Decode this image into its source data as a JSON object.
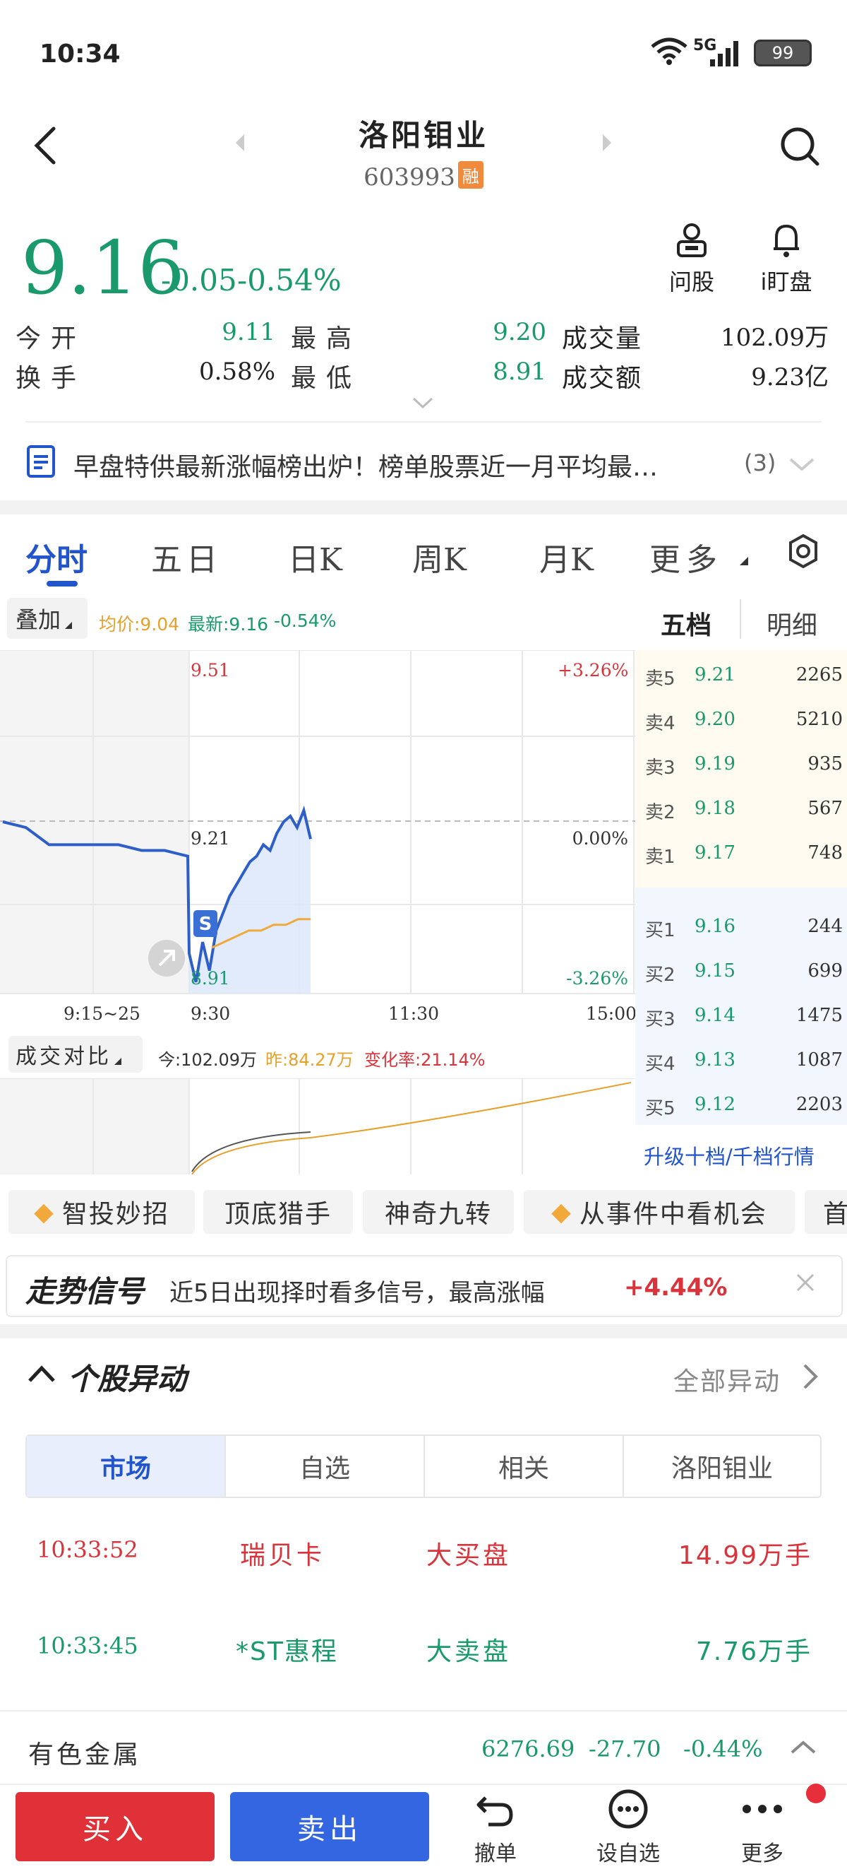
{
  "status_bar": {
    "time": "10:34",
    "network": "5G",
    "battery": "99"
  },
  "header": {
    "name": "洛阳钼业",
    "code": "603993",
    "badge": "融"
  },
  "quote": {
    "price": "9.16",
    "change": "-0.05",
    "change_pct": "-0.54%"
  },
  "actions": [
    {
      "label": "问股",
      "icon": "robot-icon"
    },
    {
      "label": "i盯盘",
      "icon": "bell-icon"
    }
  ],
  "stats": [
    {
      "label": "今开",
      "value": "9.11",
      "color": "#1a9a6c"
    },
    {
      "label": "最高",
      "value": "9.20",
      "color": "#1a9a6c"
    },
    {
      "label": "成交量",
      "value": "102.09万",
      "color": "#222222"
    },
    {
      "label": "换手",
      "value": "0.58%",
      "color": "#222222"
    },
    {
      "label": "最低",
      "value": "8.91",
      "color": "#1a9a6c"
    },
    {
      "label": "成交额",
      "value": "9.23亿",
      "color": "#222222"
    }
  ],
  "news": {
    "text": "早盘特供最新涨幅榜出炉！榜单股票近一月平均最…",
    "count": "(3)"
  },
  "tabs": [
    "分时",
    "五日",
    "日K",
    "周K",
    "月K",
    "更多"
  ],
  "chart_header": {
    "overlay": "叠加",
    "avg": "均价:9.04",
    "latest": "最新:9.16",
    "latest_pct": "-0.54%",
    "tab_five": "五档",
    "tab_detail": "明细"
  },
  "chart_data": {
    "type": "line",
    "y_labels_left": [
      "9.51",
      "9.21",
      "8.91"
    ],
    "y_labels_right": [
      "+3.26%",
      "0.00%",
      "-3.26%"
    ],
    "ylim": [
      8.91,
      9.51
    ],
    "x_labels": [
      "9:15~25",
      "9:30",
      "11:30",
      "15:00"
    ],
    "series": [
      {
        "name": "最新",
        "values": [
          9.21,
          9.2,
          9.17,
          9.17,
          9.17,
          9.17,
          9.16,
          9.16,
          9.15,
          8.98,
          8.93,
          9.0,
          8.95,
          9.02,
          9.05,
          9.08,
          9.1,
          9.12,
          9.14,
          9.15,
          9.17,
          9.16,
          9.19,
          9.21,
          9.22,
          9.2,
          9.23,
          9.18
        ]
      },
      {
        "name": "均价",
        "values": [
          8.99,
          9.0,
          9.01,
          9.02,
          9.02,
          9.03,
          9.03,
          9.04,
          9.04
        ]
      }
    ],
    "marker": "S"
  },
  "order_book": {
    "sell": [
      {
        "label": "卖5",
        "price": "9.21",
        "vol": "2265"
      },
      {
        "label": "卖4",
        "price": "9.20",
        "vol": "5210"
      },
      {
        "label": "卖3",
        "price": "9.19",
        "vol": "935"
      },
      {
        "label": "卖2",
        "price": "9.18",
        "vol": "567"
      },
      {
        "label": "卖1",
        "price": "9.17",
        "vol": "748"
      }
    ],
    "buy": [
      {
        "label": "买1",
        "price": "9.16",
        "vol": "244"
      },
      {
        "label": "买2",
        "price": "9.15",
        "vol": "699"
      },
      {
        "label": "买3",
        "price": "9.14",
        "vol": "1475"
      },
      {
        "label": "买4",
        "price": "9.13",
        "vol": "1087"
      },
      {
        "label": "买5",
        "price": "9.12",
        "vol": "2203"
      }
    ],
    "upgrade": "升级十档/千档行情"
  },
  "volume": {
    "label": "成交对比",
    "today": "今:102.09万",
    "yesterday": "昨:84.27万",
    "ratio": "变化率:21.14%"
  },
  "chips": [
    "智投妙招",
    "顶底猎手",
    "神奇九转",
    "从事件中看机会",
    "首"
  ],
  "signal": {
    "title": "走势信号",
    "text": "近5日出现择时看多信号，最高涨幅",
    "value": "+4.44%"
  },
  "abnormal": {
    "title": "个股异动",
    "all": "全部异动",
    "segments": [
      "市场",
      "自选",
      "相关",
      "洛阳钼业"
    ],
    "rows": [
      {
        "time": "10:33:52",
        "name": "瑞贝卡",
        "type": "大买盘",
        "vol": "14.99万手",
        "color": "#d9343b"
      },
      {
        "time": "10:33:45",
        "name": "*ST惠程",
        "type": "大卖盘",
        "vol": "7.76万手",
        "color": "#1a9a6c"
      }
    ]
  },
  "sector": {
    "name": "有色金属",
    "price": "6276.69",
    "change": "-27.70",
    "pct": "-0.44%"
  },
  "bottom": {
    "buy": "买入",
    "sell": "卖出",
    "nav": [
      "撤单",
      "设自选",
      "更多"
    ]
  }
}
